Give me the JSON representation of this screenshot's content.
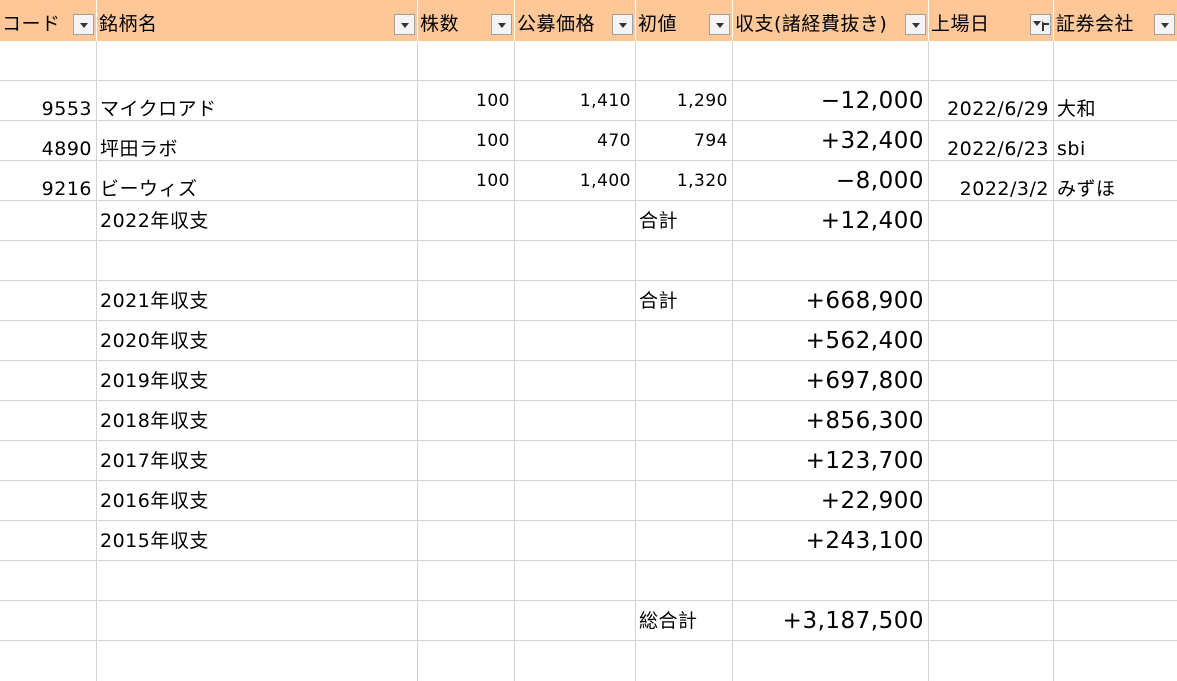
{
  "header": {
    "code": "コード",
    "name": "銘柄名",
    "shares": "株数",
    "offer_price": "公募価格",
    "first_price": "初値",
    "profit": "収支(諸経費抜き)",
    "listing_date": "上場日",
    "broker": "証券会社"
  },
  "stocks": [
    {
      "code": "9553",
      "name": "マイクロアド",
      "shares": "100",
      "offer_price": "1,410",
      "first_price": "1,290",
      "profit": "−12,000",
      "listing_date": "2022/6/29",
      "broker": "大和"
    },
    {
      "code": "4890",
      "name": "坪田ラボ",
      "shares": "100",
      "offer_price": "470",
      "first_price": "794",
      "profit": "+32,400",
      "listing_date": "2022/6/23",
      "broker": "sbi"
    },
    {
      "code": "9216",
      "name": "ビーウィズ",
      "shares": "100",
      "offer_price": "1,400",
      "first_price": "1,320",
      "profit": "−8,000",
      "listing_date": "2022/3/2",
      "broker": "みずほ"
    }
  ],
  "year2022": {
    "label": "2022年収支",
    "total_label": "合計",
    "total": "+12,400"
  },
  "year2021": {
    "label": "2021年収支",
    "total_label": "合計",
    "total": "+668,900"
  },
  "past_years": [
    {
      "label": "2020年収支",
      "total": "+562,400"
    },
    {
      "label": "2019年収支",
      "total": "+697,800"
    },
    {
      "label": "2018年収支",
      "total": "+856,300"
    },
    {
      "label": "2017年収支",
      "total": "+123,700"
    },
    {
      "label": "2016年収支",
      "total": "+22,900"
    },
    {
      "label": "2015年収支",
      "total": "+243,100"
    }
  ],
  "grand_total": {
    "label": "総合計",
    "value": "+3,187,500"
  },
  "colors": {
    "header_bg": "#fdc797",
    "grid": "#d4d4d4"
  }
}
